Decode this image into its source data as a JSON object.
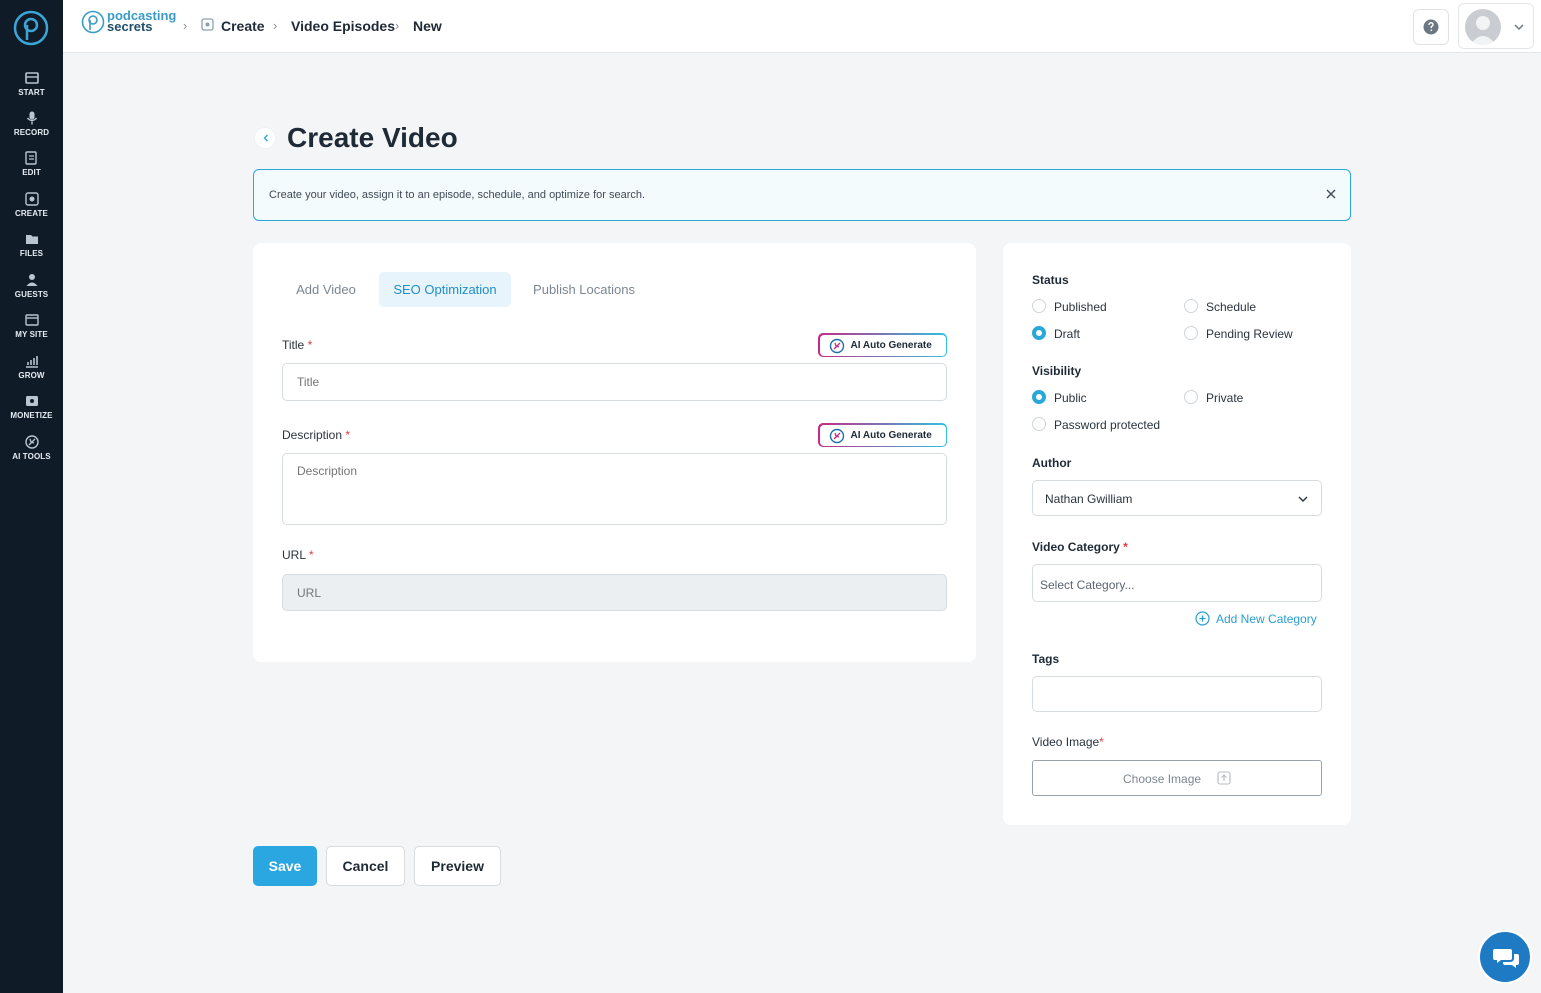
{
  "sidebar": {
    "items": [
      {
        "label": "START",
        "icon": "start-icon"
      },
      {
        "label": "RECORD",
        "icon": "microphone-icon"
      },
      {
        "label": "EDIT",
        "icon": "edit-icon"
      },
      {
        "label": "CREATE",
        "icon": "create-icon"
      },
      {
        "label": "FILES",
        "icon": "files-icon"
      },
      {
        "label": "GUESTS",
        "icon": "guests-icon"
      },
      {
        "label": "MY SITE",
        "icon": "site-icon"
      },
      {
        "label": "GROW",
        "icon": "grow-icon"
      },
      {
        "label": "MONETIZE",
        "icon": "monetize-icon"
      },
      {
        "label": "AI TOOLS",
        "icon": "ai-tools-icon"
      }
    ]
  },
  "header": {
    "brand_line1": "podcasting",
    "brand_line2": "secrets",
    "breadcrumb": [
      "Create",
      "Video Episodes",
      "New"
    ]
  },
  "page": {
    "title": "Create Video",
    "info_text": "Create your video, assign it to an episode, schedule, and optimize for search."
  },
  "tabs": [
    {
      "label": "Add Video",
      "active": false
    },
    {
      "label": "SEO Optimization",
      "active": true
    },
    {
      "label": "Publish Locations",
      "active": false
    }
  ],
  "form": {
    "ai_label": "AI Auto Generate",
    "title_label": "Title",
    "title_placeholder": "Title",
    "description_label": "Description",
    "description_placeholder": "Description",
    "url_label": "URL",
    "url_placeholder": "URL",
    "required_mark": "*"
  },
  "sidepanel": {
    "status_label": "Status",
    "status_options": [
      "Published",
      "Schedule",
      "Draft",
      "Pending Review"
    ],
    "status_selected": "Draft",
    "visibility_label": "Visibility",
    "visibility_options": [
      "Public",
      "Private",
      "Password protected"
    ],
    "visibility_selected": "Public",
    "author_label": "Author",
    "author_value": "Nathan Gwilliam",
    "category_label": "Video Category",
    "category_placeholder": "Select Category...",
    "add_category": "Add New Category",
    "tags_label": "Tags",
    "image_label": "Video Image",
    "choose_image": "Choose Image"
  },
  "actions": {
    "save": "Save",
    "cancel": "Cancel",
    "preview": "Preview"
  },
  "colors": {
    "accent": "#2aa7e1",
    "sidebar": "#0f1b26"
  }
}
